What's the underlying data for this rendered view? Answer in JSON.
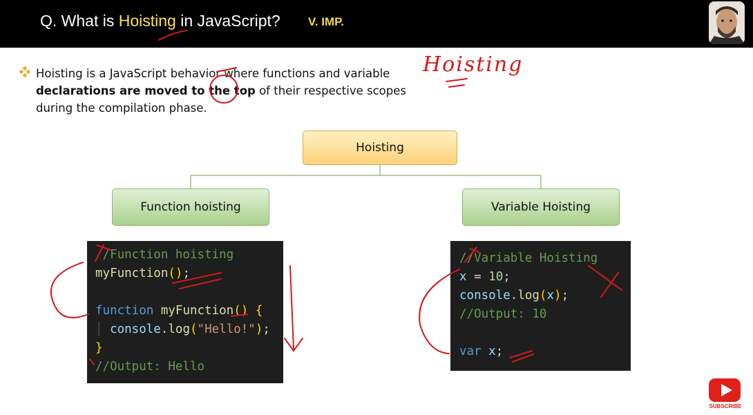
{
  "header": {
    "title_prefix": "Q. What is ",
    "title_highlight": "Hoisting",
    "title_suffix": " in JavaScript?",
    "badge": "V. IMP."
  },
  "bullet": {
    "part1": "Hoisting is a JavaScript behavior where functions and variable ",
    "bold": "declarations are moved to the top",
    "part2": " of their respective scopes during the compilation phase."
  },
  "diagram": {
    "root": "Hoisting",
    "left": "Function hoisting",
    "right": "Variable Hoisting"
  },
  "code_left": {
    "comment": "//Function hoisting",
    "call_name": "myFunction",
    "call_tail": ";",
    "kw_function": "function",
    "decl_name": "myFunction",
    "body_obj": "console",
    "body_method": "log",
    "body_str": "\"Hello!\"",
    "output": "//Output: Hello"
  },
  "code_right": {
    "comment": "//Variable Hoisting",
    "assign_var": "x",
    "assign_op": " = ",
    "assign_num": "10",
    "assign_tail": ";",
    "log_obj": "console",
    "log_method": "log",
    "log_arg": "x",
    "output": "//Output: 10",
    "kw_var": "var",
    "decl_var": "x"
  },
  "annotation": {
    "handwriting": "Hoisting"
  },
  "subscribe": {
    "label": "SUBSCRIBE"
  },
  "colors": {
    "accent": "#ffe14d",
    "ink": "#d11a1a",
    "code_bg": "#1e1e1e"
  }
}
